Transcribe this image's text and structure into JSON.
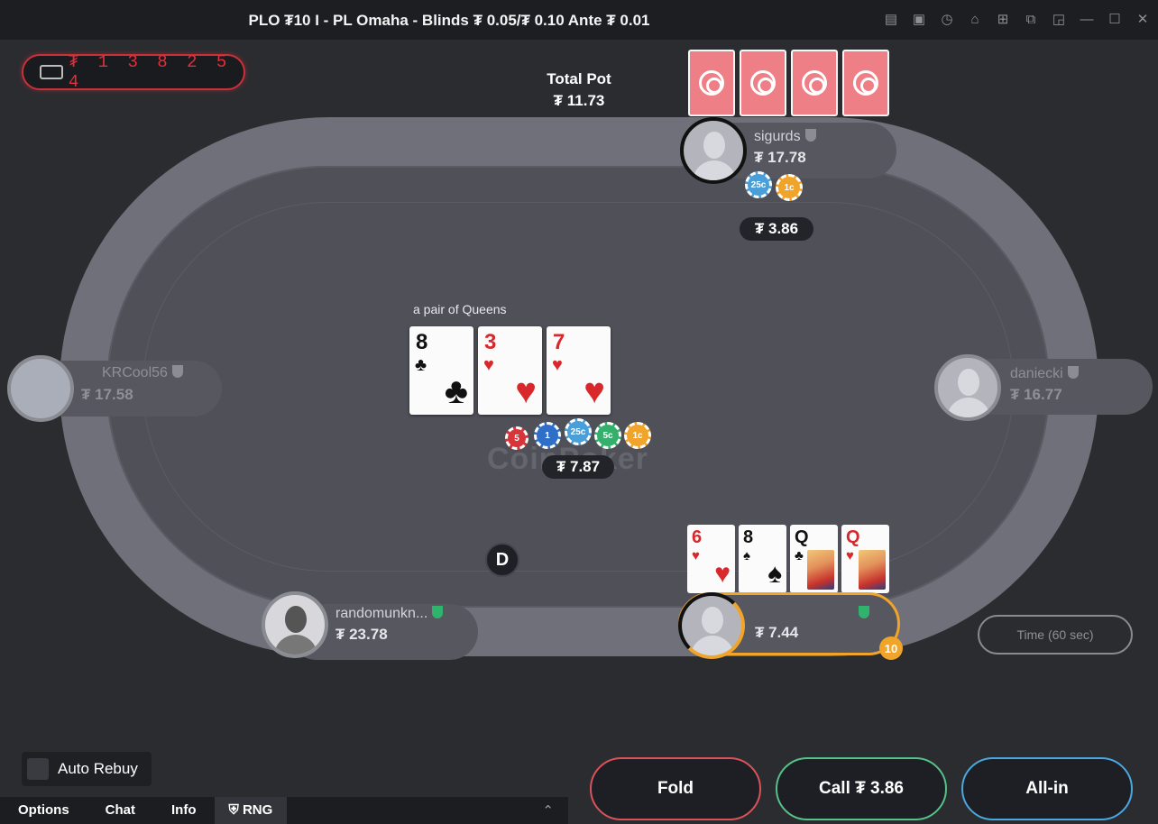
{
  "window": {
    "title": "PLO ₮10 I - PL Omaha - Blinds ₮ 0.05/₮ 0.10 Ante ₮ 0.01"
  },
  "jackpot": {
    "digits": "₮ 1 3 8 2 5 4"
  },
  "pot": {
    "label": "Total Pot",
    "value": "₮ 11.73"
  },
  "board": {
    "hand_name": "a pair of Queens",
    "cards": [
      {
        "rank": "8",
        "suit": "♣",
        "color": "black"
      },
      {
        "rank": "3",
        "suit": "♥",
        "color": "red"
      },
      {
        "rank": "7",
        "suit": "♥",
        "color": "red"
      }
    ],
    "bet": "₮ 7.87",
    "chips": [
      "5",
      "1",
      "25c",
      "5c",
      "1c"
    ]
  },
  "watermark": "CoinPoker",
  "seats": {
    "top": {
      "name": "sigurds",
      "stack": "₮ 17.78",
      "bet": "₮ 3.86",
      "chips": [
        "25c",
        "1c"
      ]
    },
    "left": {
      "name": "KRCool56",
      "stack": "₮ 17.58"
    },
    "right": {
      "name": "daniecki",
      "stack": "₮ 16.77"
    },
    "bottom_left": {
      "name": "randomunkn...",
      "stack": "₮ 23.78"
    },
    "hero": {
      "stack": "₮ 7.44",
      "timer": "10",
      "cards": [
        {
          "rank": "6",
          "suit": "♥",
          "color": "red"
        },
        {
          "rank": "8",
          "suit": "♠",
          "color": "black"
        },
        {
          "rank": "Q",
          "suit": "♣",
          "color": "black"
        },
        {
          "rank": "Q",
          "suit": "♥",
          "color": "red"
        }
      ]
    }
  },
  "dealer_button": "D",
  "time_button": "Time (60 sec)",
  "auto_rebuy": "Auto Rebuy",
  "bottom_tabs": [
    "Options",
    "Chat",
    "Info",
    "RNG"
  ],
  "actions": {
    "fold": "Fold",
    "call": "Call ₮ 3.86",
    "allin": "All-in"
  },
  "colors": {
    "fold": "#d9535b",
    "call": "#55c28a",
    "allin": "#4aa8e0",
    "accent": "#f0a42a"
  }
}
